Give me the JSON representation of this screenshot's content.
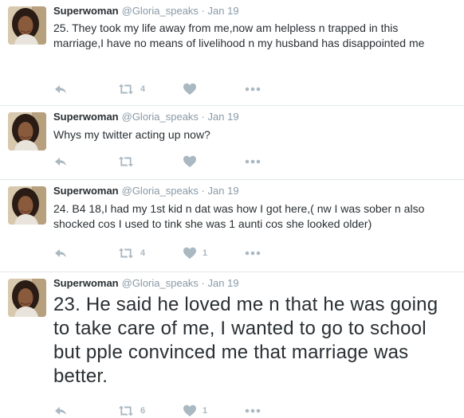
{
  "tweets": [
    {
      "name": "Superwoman",
      "handle": "@Gloria_speaks",
      "separator": "·",
      "date": "Jan 19",
      "text": "25. They took my life away from me,now am helpless n trapped in this marriage,I have no means of livelihood n my husband has disappointed me",
      "retweets": "4",
      "likes": ""
    },
    {
      "name": "Superwoman",
      "handle": "@Gloria_speaks",
      "separator": "·",
      "date": "Jan 19",
      "text": "Whys my twitter acting up now?",
      "retweets": "",
      "likes": ""
    },
    {
      "name": "Superwoman",
      "handle": "@Gloria_speaks",
      "separator": "·",
      "date": "Jan 19",
      "text": "24. B4 18,I had my 1st kid n dat was how I got here,( nw I was sober n also shocked cos I used to tink she was 1 aunti cos she looked older)",
      "retweets": "4",
      "likes": "1"
    },
    {
      "name": "Superwoman",
      "handle": "@Gloria_speaks",
      "separator": "·",
      "date": "Jan 19",
      "text": "23. He said he loved me n that he was going to take care of me, I wanted to go to school but pple convinced me that marriage was better.",
      "retweets": "6",
      "likes": "1"
    }
  ],
  "colors": {
    "name": "#292f33",
    "meta": "#8899a6",
    "action_icon": "#aab8c2",
    "divider": "#e1e8ed"
  },
  "icons": [
    "reply-icon",
    "retweet-icon",
    "like-heart-icon",
    "more-dots-icon"
  ]
}
